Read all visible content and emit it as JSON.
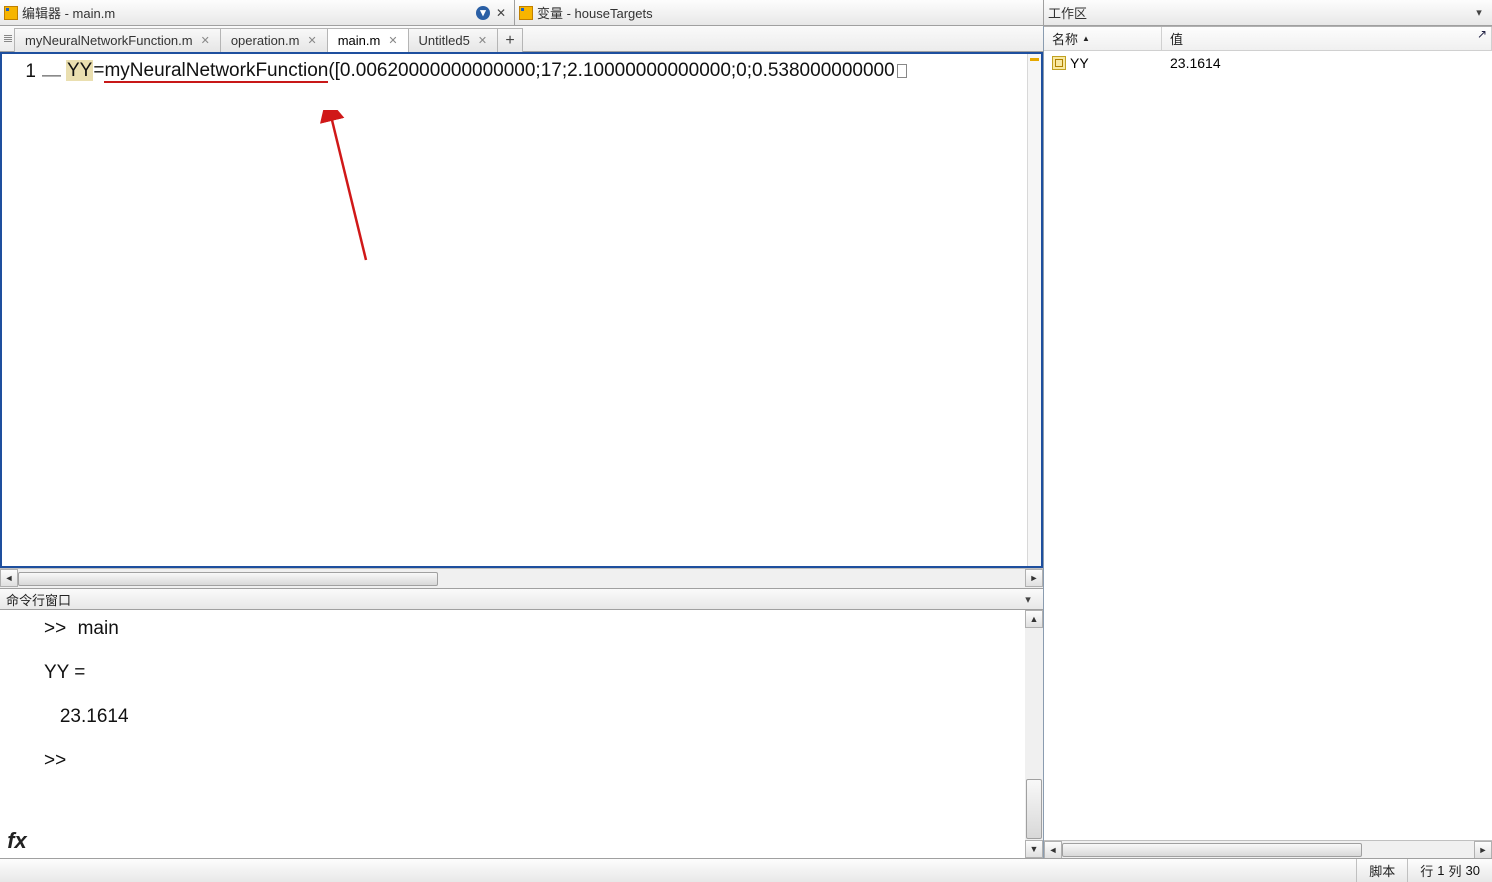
{
  "editor": {
    "title": "编辑器 - main.m",
    "tabs": [
      {
        "label": "myNeuralNetworkFunction.m",
        "closable": true,
        "active": false
      },
      {
        "label": "operation.m",
        "closable": true,
        "active": false
      },
      {
        "label": "main.m",
        "closable": true,
        "active": true
      },
      {
        "label": "Untitled5",
        "closable": true,
        "active": false
      }
    ],
    "line_number": "1",
    "fold_marker": "—",
    "code_variable": "YY",
    "code_equals": "=",
    "code_func": "myNeuralNetworkFunction",
    "code_args": "([0.00620000000000000;17;2.10000000000000;0;0.538000000000"
  },
  "variables_panel": {
    "title": "变量 - houseTargets"
  },
  "command_window": {
    "title": "命令行窗口",
    "prompt": ">>",
    "input_cmd": "main",
    "output_lines": [
      "",
      "YY =",
      "",
      "   23.1614",
      ""
    ],
    "fx_label": "fx"
  },
  "workspace": {
    "title": "工作区",
    "columns": {
      "name": "名称",
      "value": "值"
    },
    "rows": [
      {
        "name": "YY",
        "value": "23.1614"
      }
    ]
  },
  "status": {
    "script_label": "脚本",
    "row_label": "行",
    "row_value": "1",
    "col_label": "列",
    "col_value": "30"
  }
}
